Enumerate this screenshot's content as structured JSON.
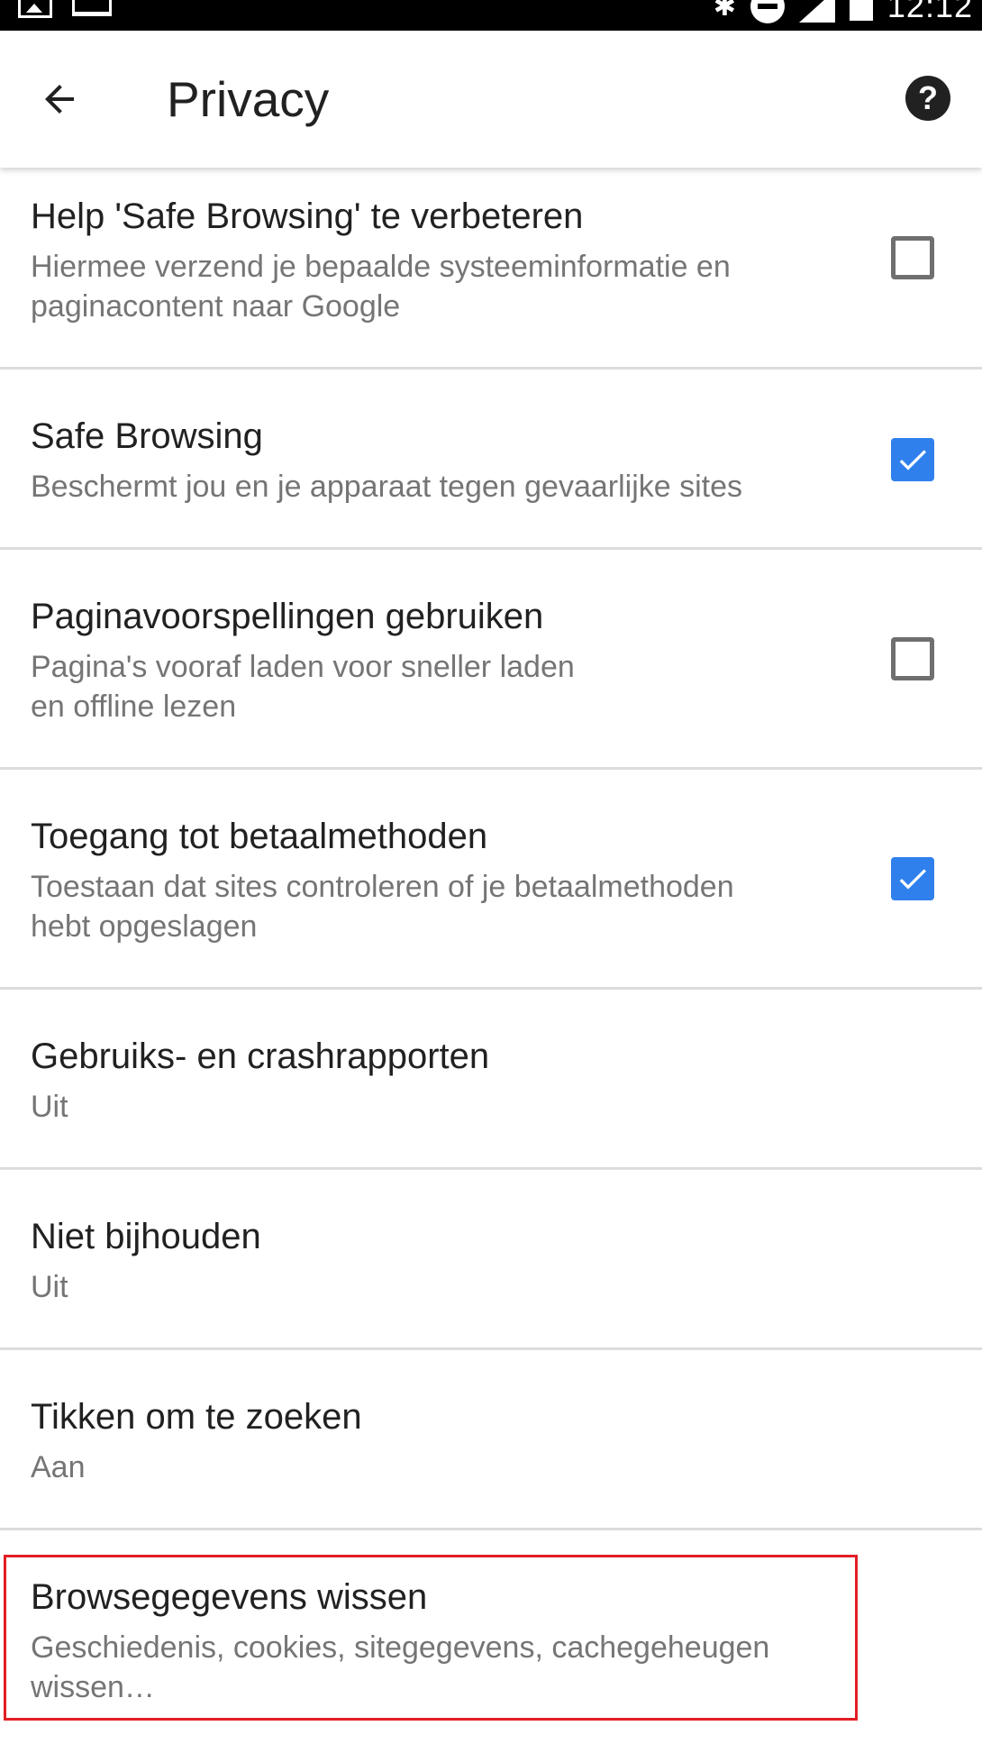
{
  "status_bar": {
    "time": "12:12",
    "icons": [
      "image-icon",
      "laptop-icon",
      "bluetooth-icon",
      "do-not-disturb-icon",
      "signal-icon",
      "battery-icon"
    ]
  },
  "app_bar": {
    "title": "Privacy",
    "back_icon": "arrow-back-icon",
    "help_icon": "help-icon",
    "help_glyph": "?"
  },
  "settings": [
    {
      "title": "Help 'Safe Browsing' te verbeteren",
      "subtitle_lines": [
        "Hiermee verzend je bepaalde systeeminformatie en",
        "paginacontent naar Google"
      ],
      "checked": false
    },
    {
      "title": "Safe Browsing",
      "subtitle_lines": [
        "Beschermt jou en je apparaat tegen gevaarlijke sites"
      ],
      "checked": true
    },
    {
      "title": "Paginavoorspellingen gebruiken",
      "subtitle_lines": [
        "Pagina's vooraf laden voor sneller laden",
        "en offline lezen"
      ],
      "checked": false
    },
    {
      "title": "Toegang tot betaalmethoden",
      "subtitle_lines": [
        "Toestaan dat sites controleren of je betaalmethoden",
        "hebt opgeslagen"
      ],
      "checked": true
    },
    {
      "title": "Gebruiks- en crashrapporten",
      "subtitle_lines": [
        "Uit"
      ]
    },
    {
      "title": "Niet bijhouden",
      "subtitle_lines": [
        "Uit"
      ]
    },
    {
      "title": "Tikken om te zoeken",
      "subtitle_lines": [
        "Aan"
      ]
    },
    {
      "title": "Browsegegevens wissen",
      "subtitle_lines": [
        "Geschiedenis, cookies, sitegegevens, cachegeheugen",
        "wissen…"
      ],
      "highlighted": true
    }
  ],
  "colors": {
    "checkbox_checked": "#2f80ed",
    "checkbox_unchecked_border": "#6f6f6f",
    "highlight_border": "#e31e24",
    "divider": "#dcdcdc"
  }
}
